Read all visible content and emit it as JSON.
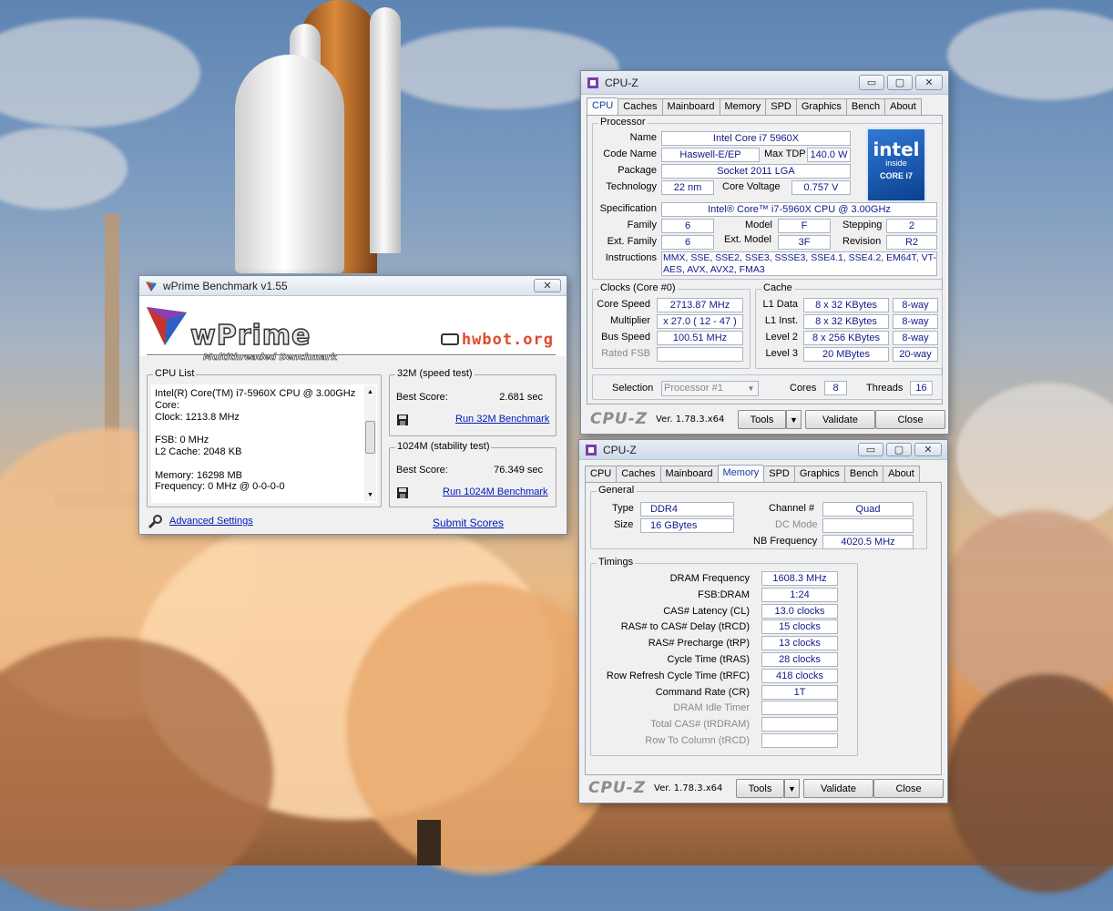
{
  "wprime": {
    "title": "wPrime Benchmark v1.55",
    "logo_text": "wPrime",
    "logo_subtitle": "Multithreaded Benchmark",
    "hwbot_text": "hwbot.org",
    "cpu_list": {
      "label": "CPU List",
      "lines": [
        "Intel(R) Core(TM) i7-5960X CPU @ 3.00GHz",
        "Core:",
        "Clock: 1213.8 MHz",
        "",
        "FSB: 0 MHz",
        "L2 Cache: 2048 KB",
        "",
        "Memory: 16298 MB",
        "Frequency: 0 MHz @ 0-0-0-0"
      ]
    },
    "test32": {
      "label": "32M (speed test)",
      "best_label": "Best Score:",
      "best_value": "2.681 sec",
      "run_label": "Run 32M Benchmark"
    },
    "test1024": {
      "label": "1024M (stability test)",
      "best_label": "Best Score:",
      "best_value": "76.349 sec",
      "run_label": "Run 1024M Benchmark"
    },
    "advanced_label": "Advanced Settings",
    "submit_label": "Submit Scores",
    "close_glyph": "✕"
  },
  "cpuz_common": {
    "title": "CPU-Z",
    "tabs": [
      "CPU",
      "Caches",
      "Mainboard",
      "Memory",
      "SPD",
      "Graphics",
      "Bench",
      "About"
    ],
    "brand": "CPU-Z",
    "version": "Ver. 1.78.3.x64",
    "tools_label": "Tools",
    "validate_label": "Validate",
    "close_label": "Close",
    "min_glyph": "▭",
    "max_glyph": "▢",
    "close_glyph": "✕"
  },
  "cpuz_cpu": {
    "active_tab": "CPU",
    "processor": {
      "label": "Processor",
      "name_label": "Name",
      "name": "Intel Core i7 5960X",
      "codename_label": "Code Name",
      "codename": "Haswell-E/EP",
      "maxtdp_label": "Max TDP",
      "maxtdp": "140.0 W",
      "package_label": "Package",
      "package": "Socket 2011 LGA",
      "technology_label": "Technology",
      "technology": "22 nm",
      "corevoltage_label": "Core Voltage",
      "corevoltage": "0.757 V",
      "spec_label": "Specification",
      "spec": "Intel® Core™ i7-5960X CPU @ 3.00GHz",
      "family_label": "Family",
      "family": "6",
      "model_label": "Model",
      "model": "F",
      "stepping_label": "Stepping",
      "stepping": "2",
      "extfamily_label": "Ext. Family",
      "extfamily": "6",
      "extmodel_label": "Ext. Model",
      "extmodel": "3F",
      "revision_label": "Revision",
      "revision": "R2",
      "instructions_label": "Instructions",
      "instructions_line1": "MMX, SSE, SSE2, SSE3, SSSE3, SSE4.1, SSE4.2, EM64T, VT-x,",
      "instructions_line2": "AES, AVX, AVX2, FMA3"
    },
    "intel_badge": {
      "brand": "intel",
      "inside": "inside",
      "core": "CORE i7"
    },
    "clocks": {
      "label": "Clocks (Core #0)",
      "corespeed_label": "Core Speed",
      "corespeed": "2713.87 MHz",
      "multiplier_label": "Multiplier",
      "multiplier": "x 27.0 ( 12 - 47 )",
      "busspeed_label": "Bus Speed",
      "busspeed": "100.51 MHz",
      "ratedfsb_label": "Rated FSB",
      "ratedfsb": ""
    },
    "cache": {
      "label": "Cache",
      "l1data_label": "L1 Data",
      "l1data": "8 x 32 KBytes",
      "l1data_way": "8-way",
      "l1inst_label": "L1 Inst.",
      "l1inst": "8 x 32 KBytes",
      "l1inst_way": "8-way",
      "l2_label": "Level 2",
      "l2": "8 x 256 KBytes",
      "l2_way": "8-way",
      "l3_label": "Level 3",
      "l3": "20 MBytes",
      "l3_way": "20-way"
    },
    "selection": {
      "label": "Selection",
      "value": "Processor #1",
      "cores_label": "Cores",
      "cores": "8",
      "threads_label": "Threads",
      "threads": "16"
    }
  },
  "cpuz_mem": {
    "active_tab": "Memory",
    "general": {
      "label": "General",
      "type_label": "Type",
      "type": "DDR4",
      "size_label": "Size",
      "size": "16 GBytes",
      "channel_label": "Channel #",
      "channel": "Quad",
      "dcmode_label": "DC Mode",
      "dcmode": "",
      "nbfreq_label": "NB Frequency",
      "nbfreq": "4020.5 MHz"
    },
    "timings": {
      "label": "Timings",
      "rows": [
        {
          "label": "DRAM Frequency",
          "value": "1608.3 MHz",
          "dim": false
        },
        {
          "label": "FSB:DRAM",
          "value": "1:24",
          "dim": false
        },
        {
          "label": "CAS# Latency (CL)",
          "value": "13.0 clocks",
          "dim": false
        },
        {
          "label": "RAS# to CAS# Delay (tRCD)",
          "value": "15 clocks",
          "dim": false
        },
        {
          "label": "RAS# Precharge (tRP)",
          "value": "13 clocks",
          "dim": false
        },
        {
          "label": "Cycle Time (tRAS)",
          "value": "28 clocks",
          "dim": false
        },
        {
          "label": "Row Refresh Cycle Time (tRFC)",
          "value": "418 clocks",
          "dim": false
        },
        {
          "label": "Command Rate (CR)",
          "value": "1T",
          "dim": false
        },
        {
          "label": "DRAM Idle Timer",
          "value": "",
          "dim": true
        },
        {
          "label": "Total CAS# (tRDRAM)",
          "value": "",
          "dim": true
        },
        {
          "label": "Row To Column (tRCD)",
          "value": "",
          "dim": true
        }
      ]
    }
  }
}
